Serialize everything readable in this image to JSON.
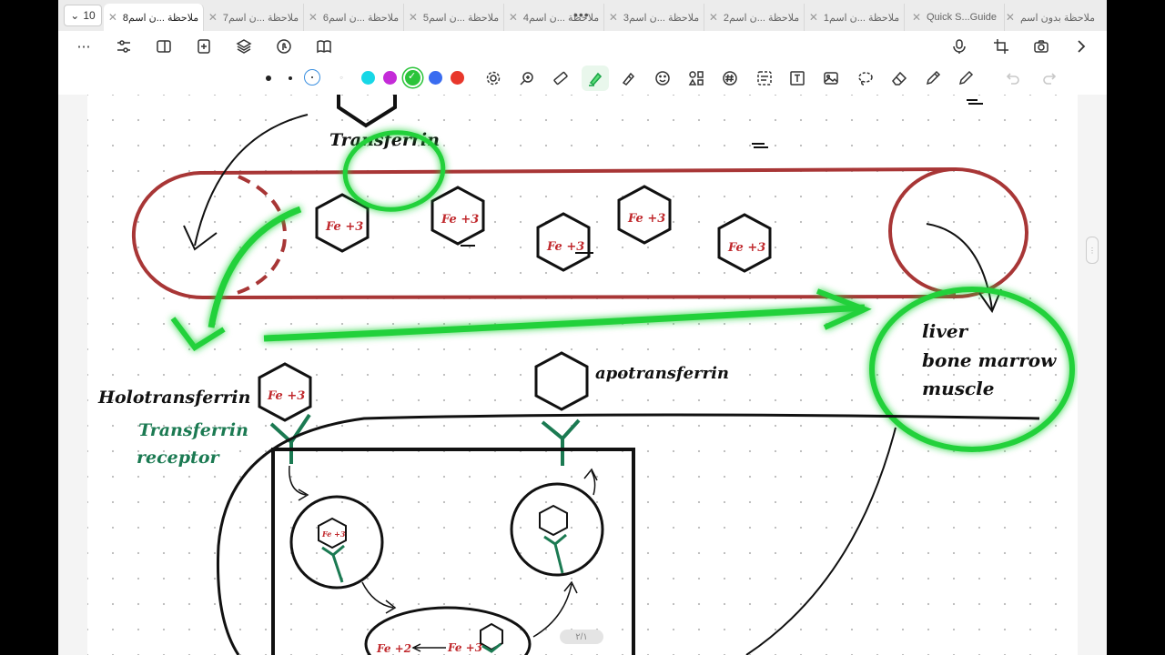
{
  "tabs": {
    "count": "10",
    "items": [
      {
        "label": "ملاحظة ...ن اسم8",
        "active": true
      },
      {
        "label": "ملاحظة ...ن اسم7",
        "active": false
      },
      {
        "label": "ملاحظة ...ن اسم6",
        "active": false
      },
      {
        "label": "ملاحظة ...ن اسم5",
        "active": false
      },
      {
        "label": "ملاحظة ...ن اسم4",
        "active": false
      },
      {
        "label": "ملاحظة ...ن اسم3",
        "active": false
      },
      {
        "label": "ملاحظة ...ن اسم2",
        "active": false
      },
      {
        "label": "ملاحظة ...ن اسم1",
        "active": false
      },
      {
        "label": "Quick S...Guide",
        "active": false
      },
      {
        "label": "ملاحظة بدون اسم",
        "active": false
      }
    ]
  },
  "pen_colors": [
    "#17d7e6",
    "#c42bd8",
    "#2bc43a",
    "#3a6cf0",
    "#e8372b"
  ],
  "selected_color": "#2bc43a",
  "accent": "#21c45b",
  "drawing": {
    "transferrin_top": "Transferrin",
    "fe_label": "Fe +3",
    "fe2_label": "Fe +2",
    "holotransferrin": "Holotransferrin",
    "receptor_line1": "Transferrin",
    "receptor_line2": "receptor",
    "apotransferrin": "apotransferrin",
    "organs": [
      "liver",
      "bone marrow",
      "muscle"
    ]
  },
  "page_indicator": "٢/١"
}
